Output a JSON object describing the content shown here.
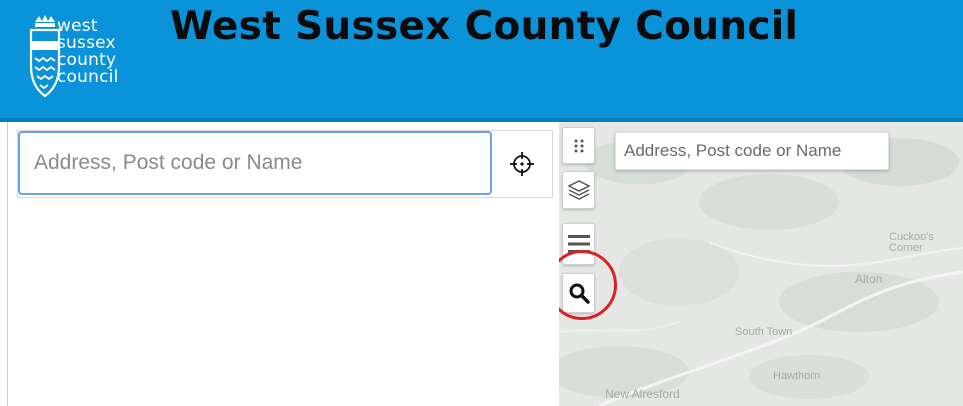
{
  "header": {
    "title": "West Sussex County Council",
    "logo_lines": [
      "west",
      "sussex",
      "county",
      "council"
    ],
    "background": "#0a93d9"
  },
  "search": {
    "placeholder": "Address, Post code or Name",
    "value": "",
    "locate_icon": "crosshair-icon"
  },
  "map": {
    "search_placeholder": "Address, Post code or Name",
    "place_labels": [
      "Cuckoo's Corner",
      "Alton",
      "South Town",
      "Hawthorn",
      "New Alresford"
    ],
    "toolbar_icons": [
      "grid-icon",
      "layers-icon",
      "list-icon",
      "search-icon"
    ],
    "highlight_color": "#de1f26"
  }
}
